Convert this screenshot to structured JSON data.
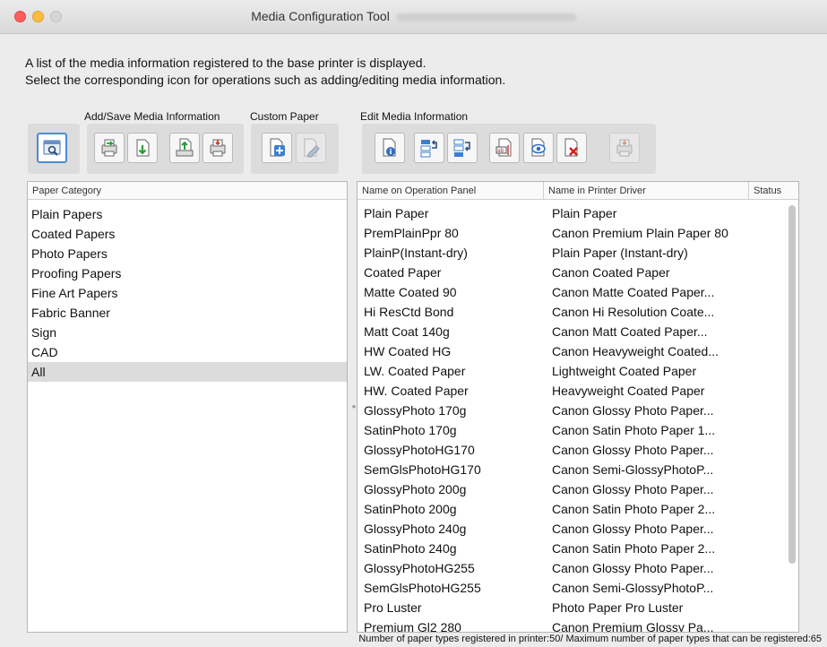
{
  "window": {
    "title": "Media Configuration Tool"
  },
  "description": {
    "line1": "A list of the media information registered to the base printer is displayed.",
    "line2": "Select the corresponding icon for operations such as adding/editing media information."
  },
  "toolbar": {
    "add_save_label": "Add/Save Media Information",
    "custom_paper_label": "Custom Paper",
    "edit_media_label": "Edit Media Information",
    "icons": [
      "search-printer-icon",
      "import-media-icon",
      "download-media-icon",
      "save-media-icon",
      "export-media-icon",
      "add-custom-paper-icon",
      "edit-custom-paper-icon",
      "media-info-icon",
      "move-up-icon",
      "move-down-icon",
      "rename-icon",
      "display-toggle-icon",
      "delete-icon",
      "printer-update-icon"
    ]
  },
  "category_panel": {
    "header": "Paper Category",
    "items": [
      "Plain Papers",
      "Coated Papers",
      "Photo Papers",
      "Proofing Papers",
      "Fine Art Papers",
      "Fabric Banner",
      "Sign",
      "CAD",
      "All"
    ],
    "selected": "All"
  },
  "media_table": {
    "columns": [
      "Name on Operation Panel",
      "Name in Printer Driver",
      "Status"
    ],
    "rows": [
      [
        "Plain Paper",
        "Plain Paper"
      ],
      [
        "PremPlainPpr 80",
        "Canon Premium Plain Paper 80"
      ],
      [
        "PlainP(Instant-dry)",
        "Plain Paper (Instant-dry)"
      ],
      [
        "Coated Paper",
        "Canon Coated Paper"
      ],
      [
        "Matte Coated 90",
        "Canon Matte Coated Paper..."
      ],
      [
        "Hi ResCtd Bond",
        "Canon Hi Resolution Coate..."
      ],
      [
        "Matt Coat 140g",
        "Canon Matt Coated Paper..."
      ],
      [
        "HW Coated HG",
        "Canon Heavyweight Coated..."
      ],
      [
        "LW. Coated Paper",
        "Lightweight Coated Paper"
      ],
      [
        "HW. Coated Paper",
        "Heavyweight Coated Paper"
      ],
      [
        "GlossyPhoto 170g",
        "Canon Glossy Photo Paper..."
      ],
      [
        "SatinPhoto 170g",
        "Canon Satin Photo Paper 1..."
      ],
      [
        "GlossyPhotoHG170",
        "Canon Glossy Photo Paper..."
      ],
      [
        "SemGlsPhotoHG170",
        "Canon Semi-GlossyPhotoP..."
      ],
      [
        "GlossyPhoto 200g",
        "Canon Glossy Photo Paper..."
      ],
      [
        "SatinPhoto 200g",
        "Canon Satin Photo Paper 2..."
      ],
      [
        "GlossyPhoto 240g",
        "Canon Glossy Photo Paper..."
      ],
      [
        "SatinPhoto 240g",
        "Canon Satin Photo Paper 2..."
      ],
      [
        "GlossyPhotoHG255",
        "Canon Glossy Photo Paper..."
      ],
      [
        "SemGlsPhotoHG255",
        "Canon Semi-GlossyPhotoP..."
      ],
      [
        "Pro Luster",
        "Photo Paper Pro Luster"
      ],
      [
        "Premium Gl2 280",
        "Canon Premium Glossy Pa..."
      ]
    ]
  },
  "status_bar": {
    "text": "Number of paper types registered in printer:50/ Maximum number of paper types that can be registered:65"
  },
  "colors": {
    "selection_border": "#4f8bd6",
    "selected_row": "#dcdcdc"
  }
}
